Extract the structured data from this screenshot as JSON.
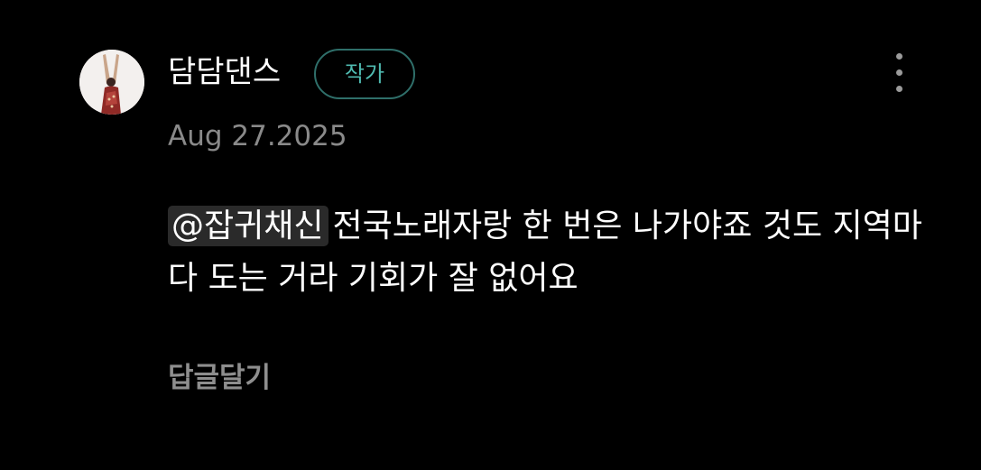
{
  "comment": {
    "author": {
      "name": "담담댄스",
      "badge": "작가",
      "avatar_icon": "dancer-avatar"
    },
    "date": "Aug 27.2025",
    "mention": "@잡귀채신",
    "text": "전국노래자랑 한 번은 나가야죠 것도 지역마다 도는 거라 기회가 잘 없어요",
    "reply_label": "답글달기",
    "more_icon": "more-vertical-icon"
  },
  "colors": {
    "background": "#000000",
    "text": "#ffffff",
    "muted": "#8a8a8a",
    "badge_border": "#2f6f6a",
    "badge_text": "#4fbab0",
    "mention_bg": "#2a2a2a"
  }
}
